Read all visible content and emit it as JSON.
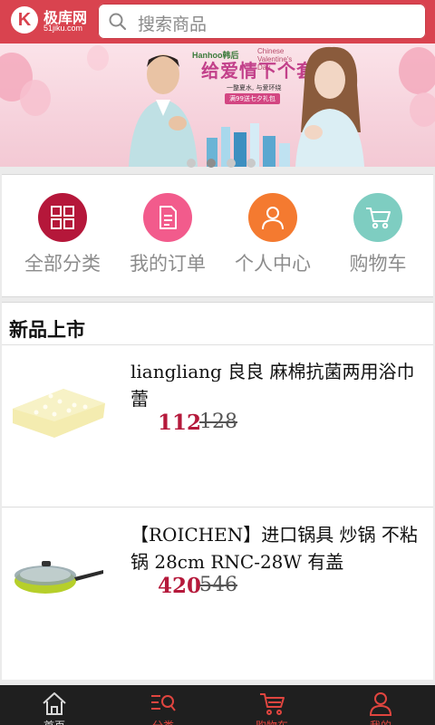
{
  "header": {
    "logo_badge": "K",
    "logo_name": "极库网",
    "logo_domain": "51jiku.com",
    "search_placeholder": "搜索商品"
  },
  "banner": {
    "brand": "Hanhoo韩后",
    "valentine": "Chinese Valentine's Day",
    "slogan": "给爱情下个套",
    "sub_line": "一整夏水, 与爱环绕",
    "sub_tag": "满99送七夕礼包",
    "slide_count": 4,
    "active_slide": 2
  },
  "quick_menu": [
    {
      "label": "全部分类",
      "icon": "grid-icon",
      "color": "#b5173a"
    },
    {
      "label": "我的订单",
      "icon": "document-icon",
      "color": "#f25b8c"
    },
    {
      "label": "个人中心",
      "icon": "person-icon",
      "color": "#f47a30"
    },
    {
      "label": "购物车",
      "icon": "cart-icon",
      "color": "#7ecdc1"
    }
  ],
  "new_arrivals": {
    "title": "新品上市",
    "products": [
      {
        "name": "liangliang 良良 麻棉抗菌两用浴巾 蕾",
        "price": "112",
        "old_price": "128",
        "image": "bath-towel"
      },
      {
        "name": "【ROICHEN】进口锅具 炒锅 不粘锅 28cm RNC-28W 有盖",
        "price": "420",
        "old_price": "546",
        "image": "wok-pan"
      }
    ]
  },
  "bottom_nav": [
    {
      "label": "首页",
      "icon": "home-icon",
      "color": "#d8d8d8"
    },
    {
      "label": "分类",
      "icon": "category-search-icon",
      "color": "#e0453f"
    },
    {
      "label": "购物车",
      "icon": "cart-icon",
      "color": "#e0453f"
    },
    {
      "label": "我的",
      "icon": "user-icon",
      "color": "#e0453f"
    }
  ]
}
